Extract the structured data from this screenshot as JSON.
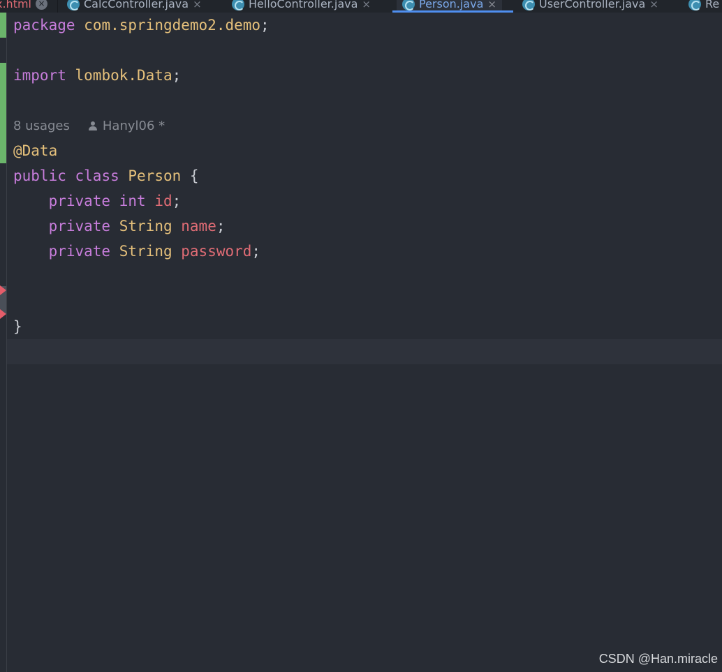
{
  "tabs": [
    {
      "label": "x.html",
      "active": false
    },
    {
      "label": "CalcController.java",
      "active": false
    },
    {
      "label": "HelloController.java",
      "active": false
    },
    {
      "label": "Person.java",
      "active": true
    },
    {
      "label": "UserController.java",
      "active": false
    },
    {
      "label": "Re",
      "active": false
    }
  ],
  "tab_close_glyph": "×",
  "editor": {
    "package_kw": "package",
    "package_name": "com.springdemo2.demo",
    "import_kw": "import",
    "import_name": "lombok.Data",
    "semicolon": ";",
    "inlay_usages": "8 usages",
    "inlay_author": "Hanyl06 *",
    "annotation": "@Data",
    "public_kw": "public",
    "class_kw": "class",
    "class_name": "Person",
    "open_brace": "{",
    "close_brace": "}",
    "fields": [
      {
        "modifier": "private",
        "type": "int",
        "name": "id"
      },
      {
        "modifier": "private",
        "type": "String",
        "name": "name"
      },
      {
        "modifier": "private",
        "type": "String",
        "name": "password"
      }
    ]
  },
  "colors": {
    "background": "#282c34",
    "keyword": "#c77ddb",
    "type": "#e5c07b",
    "field": "#e06c75",
    "active_tab_underline": "#4f8ff0",
    "vcs_added": "#6bb56b"
  },
  "watermark": "CSDN @Han.miracle"
}
